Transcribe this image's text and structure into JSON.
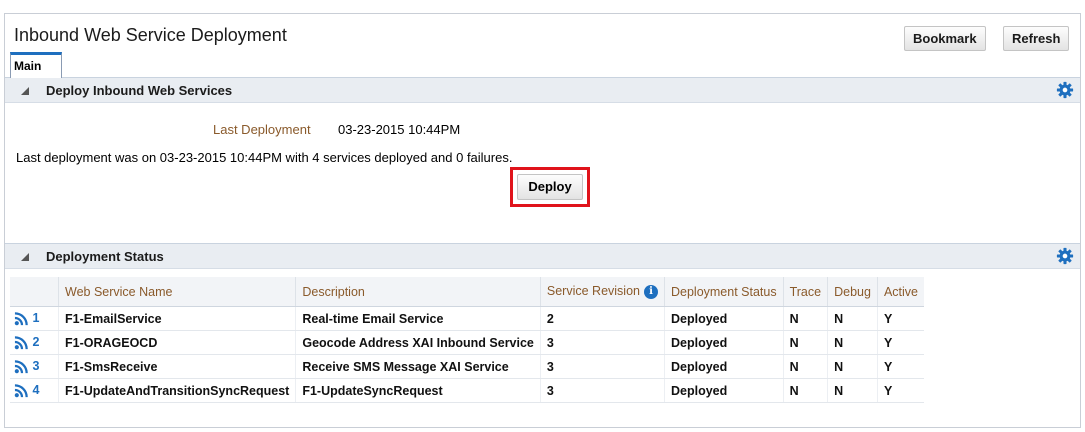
{
  "page": {
    "title": "Inbound Web Service Deployment",
    "bookmark_label": "Bookmark",
    "refresh_label": "Refresh"
  },
  "tabs": [
    {
      "label": "Main",
      "active": true
    }
  ],
  "deploy_section": {
    "title": "Deploy Inbound Web Services",
    "last_deployment_label": "Last Deployment",
    "last_deployment_value": "03-23-2015 10:44PM",
    "message": "Last deployment was on 03-23-2015 10:44PM with 4 services deployed and 0 failures.",
    "deploy_label": "Deploy"
  },
  "status_section": {
    "title": "Deployment Status",
    "info_icon_glyph": "i",
    "columns": [
      "Web Service Name",
      "Description",
      "Service Revision",
      "Deployment Status",
      "Trace",
      "Debug",
      "Active"
    ],
    "rows": [
      {
        "num": "1",
        "name": "F1-EmailService",
        "description": "Real-time Email Service",
        "revision": "2",
        "status": "Deployed",
        "trace": "N",
        "debug": "N",
        "active": "Y"
      },
      {
        "num": "2",
        "name": "F1-ORAGEOCD",
        "description": "Geocode Address XAI Inbound Service",
        "revision": "3",
        "status": "Deployed",
        "trace": "N",
        "debug": "N",
        "active": "Y"
      },
      {
        "num": "3",
        "name": "F1-SmsReceive",
        "description": "Receive SMS Message XAI Service",
        "revision": "3",
        "status": "Deployed",
        "trace": "N",
        "debug": "N",
        "active": "Y"
      },
      {
        "num": "4",
        "name": "F1-UpdateAndTransitionSyncRequest",
        "description": "F1-UpdateSyncRequest",
        "revision": "3",
        "status": "Deployed",
        "trace": "N",
        "debug": "N",
        "active": "Y"
      }
    ]
  },
  "colors": {
    "accent": "#1e6fbf",
    "label": "#8a5a2b",
    "highlight": "#e0131b"
  }
}
